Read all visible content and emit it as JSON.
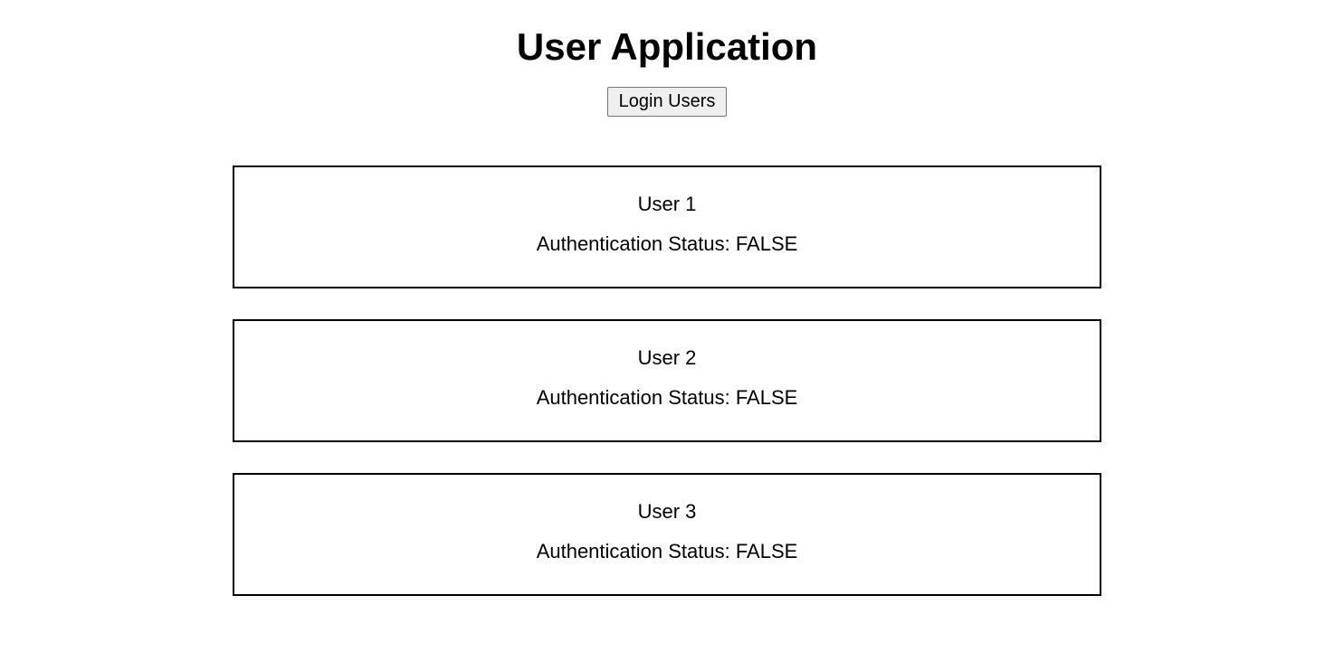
{
  "header": {
    "title": "User Application",
    "login_label": "Login Users"
  },
  "users": [
    {
      "name": "User 1",
      "status_text": "Authentication Status: FALSE"
    },
    {
      "name": "User 2",
      "status_text": "Authentication Status: FALSE"
    },
    {
      "name": "User 3",
      "status_text": "Authentication Status: FALSE"
    }
  ]
}
